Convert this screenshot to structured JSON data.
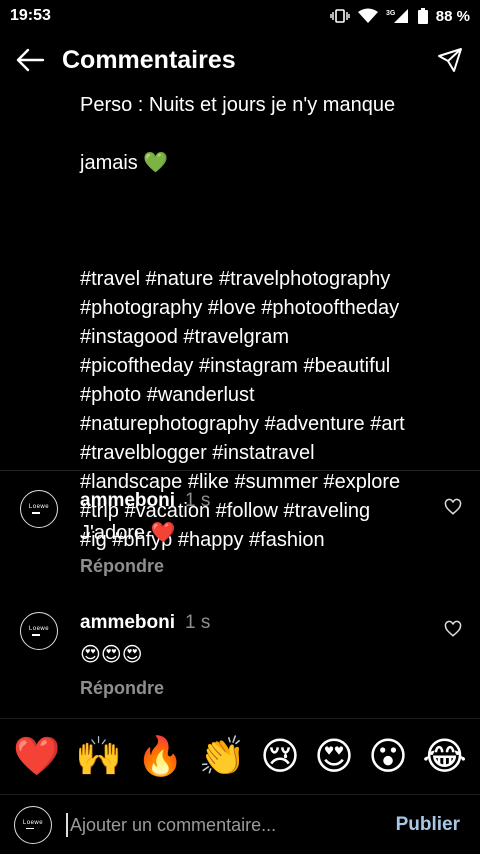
{
  "status": {
    "time": "19:53",
    "network": "3G",
    "battery": "88 %"
  },
  "header": {
    "title": "Commentaires"
  },
  "caption": {
    "partial_line": "Perso : Nuits et jours je n'y manque",
    "line2": "jamais 💚",
    "hashtags": "#travel #nature #travelphotography\n#photography #love #photooftheday\n#instagood #travelgram\n#picoftheday #instagram #beautiful\n#photo #wanderlust\n#naturephotography #adventure #art\n#travelblogger #instatravel\n#landscape #like #summer #explore\n#trip #vacation #follow #traveling\n#ig #bhfyp #happy #fashion"
  },
  "comments": [
    {
      "user": "ammeboni",
      "time": "1 s",
      "text": "J'adore ❤️",
      "reply": "Répondre"
    },
    {
      "user": "ammeboni",
      "time": "1 s",
      "text": "😍😍😍",
      "reply": "Répondre"
    }
  ],
  "avatar_logo": "Loewe",
  "emojis": [
    "❤️",
    "🙌",
    "🔥",
    "👏",
    "😢",
    "😍",
    "😮",
    "😂"
  ],
  "input": {
    "placeholder": "Ajouter un commentaire...",
    "publish_label": "Publier"
  },
  "colors": {
    "accent": "#a8c7e6",
    "muted": "#8e8e8e",
    "background": "#000000"
  }
}
